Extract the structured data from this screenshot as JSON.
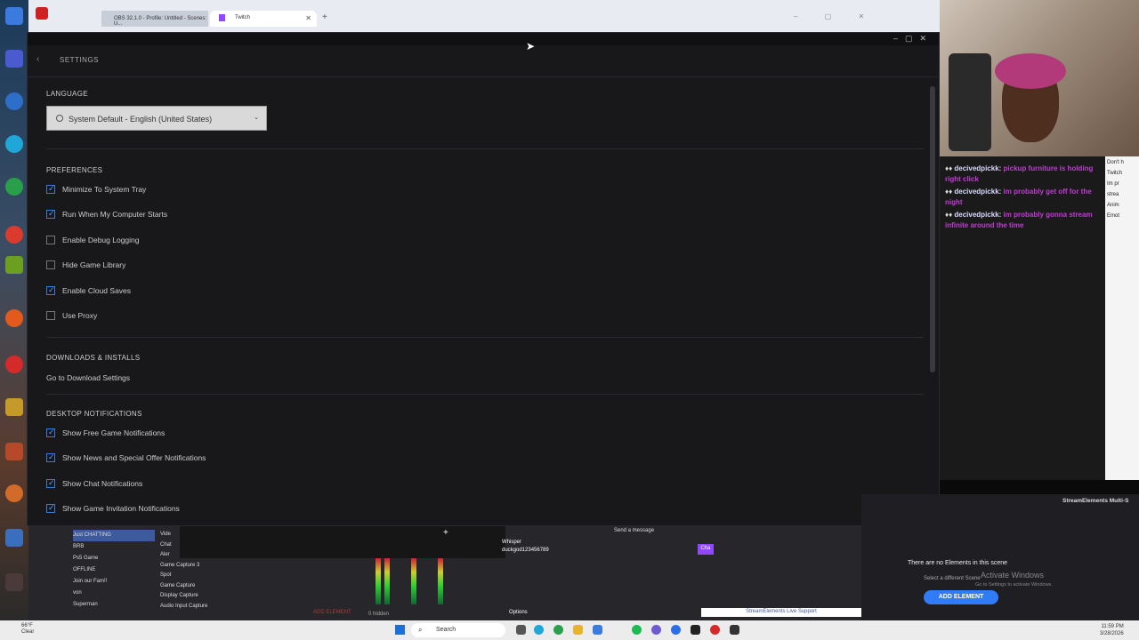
{
  "browser": {
    "obs_tab": "OBS 32.1.0 - Profile: Untitled - Scenes: U...",
    "twitch_tab": "Twitch"
  },
  "settings": {
    "header_title": "SETTINGS",
    "language_section": "LANGUAGE",
    "language_value": "System Default - English (United States)",
    "preferences_section": "PREFERENCES",
    "preferences": [
      {
        "label": "Minimize To System Tray",
        "checked": true
      },
      {
        "label": "Run When My Computer Starts",
        "checked": true
      },
      {
        "label": "Enable Debug Logging",
        "checked": false
      },
      {
        "label": "Hide Game Library",
        "checked": false
      },
      {
        "label": "Enable Cloud Saves",
        "checked": true
      },
      {
        "label": "Use Proxy",
        "checked": false
      }
    ],
    "downloads_section": "DOWNLOADS & INSTALLS",
    "downloads_link": "Go to Download Settings",
    "notifications_section": "DESKTOP NOTIFICATIONS",
    "notifications": [
      {
        "label": "Show Free Game Notifications",
        "checked": true
      },
      {
        "label": "Show News and Special Offer Notifications",
        "checked": true
      },
      {
        "label": "Show Chat Notifications",
        "checked": true
      },
      {
        "label": "Show Game Invitation Notifications",
        "checked": true
      }
    ]
  },
  "chat": {
    "lines": [
      {
        "name": "decivedpickk:",
        "msg": "pickup furniture is holding right click"
      },
      {
        "name": "decivedpickk:",
        "msg": "im probably get off for the night"
      },
      {
        "name": "decivedpickk:",
        "msg": "im probably gonna stream infinite around the time"
      }
    ]
  },
  "side_panel": [
    "Don't h",
    "Twitch",
    "Im pr",
    "strea",
    "Anim",
    "Emot"
  ],
  "obs": {
    "scenes": [
      "Just CHATTING",
      "BRB",
      "Ps5 Game",
      "OFFLINE",
      "Join our Fam!!",
      "von",
      "Superman"
    ],
    "sources": [
      "Vide",
      "Chat",
      "Aler",
      "Game Capture 3",
      "Spot",
      "Game Capture",
      "Display Capture",
      "Audio Input Capture"
    ],
    "hidden": "0 hidden",
    "whisper": "Whisper",
    "whisper_user": "duckgod123456789",
    "send_message": "Send a message",
    "chat_button": "Cha",
    "options": "Options",
    "add_element": "ADD ELEMENT",
    "se_support": "StreamElements Live Support"
  },
  "streamelements": {
    "title": "StreamElements Multi-S",
    "empty": "There are no Elements in this scene",
    "select": "Select a different Scene",
    "add_button": "ADD ELEMENT",
    "activate": "Activate Windows",
    "activate_sub": "Go to Settings to activate Windows."
  },
  "taskbar": {
    "weather_temp": "66°F",
    "weather_desc": "Clear",
    "search": "Search",
    "time": "11:59 PM",
    "date": "3/28/2026"
  }
}
